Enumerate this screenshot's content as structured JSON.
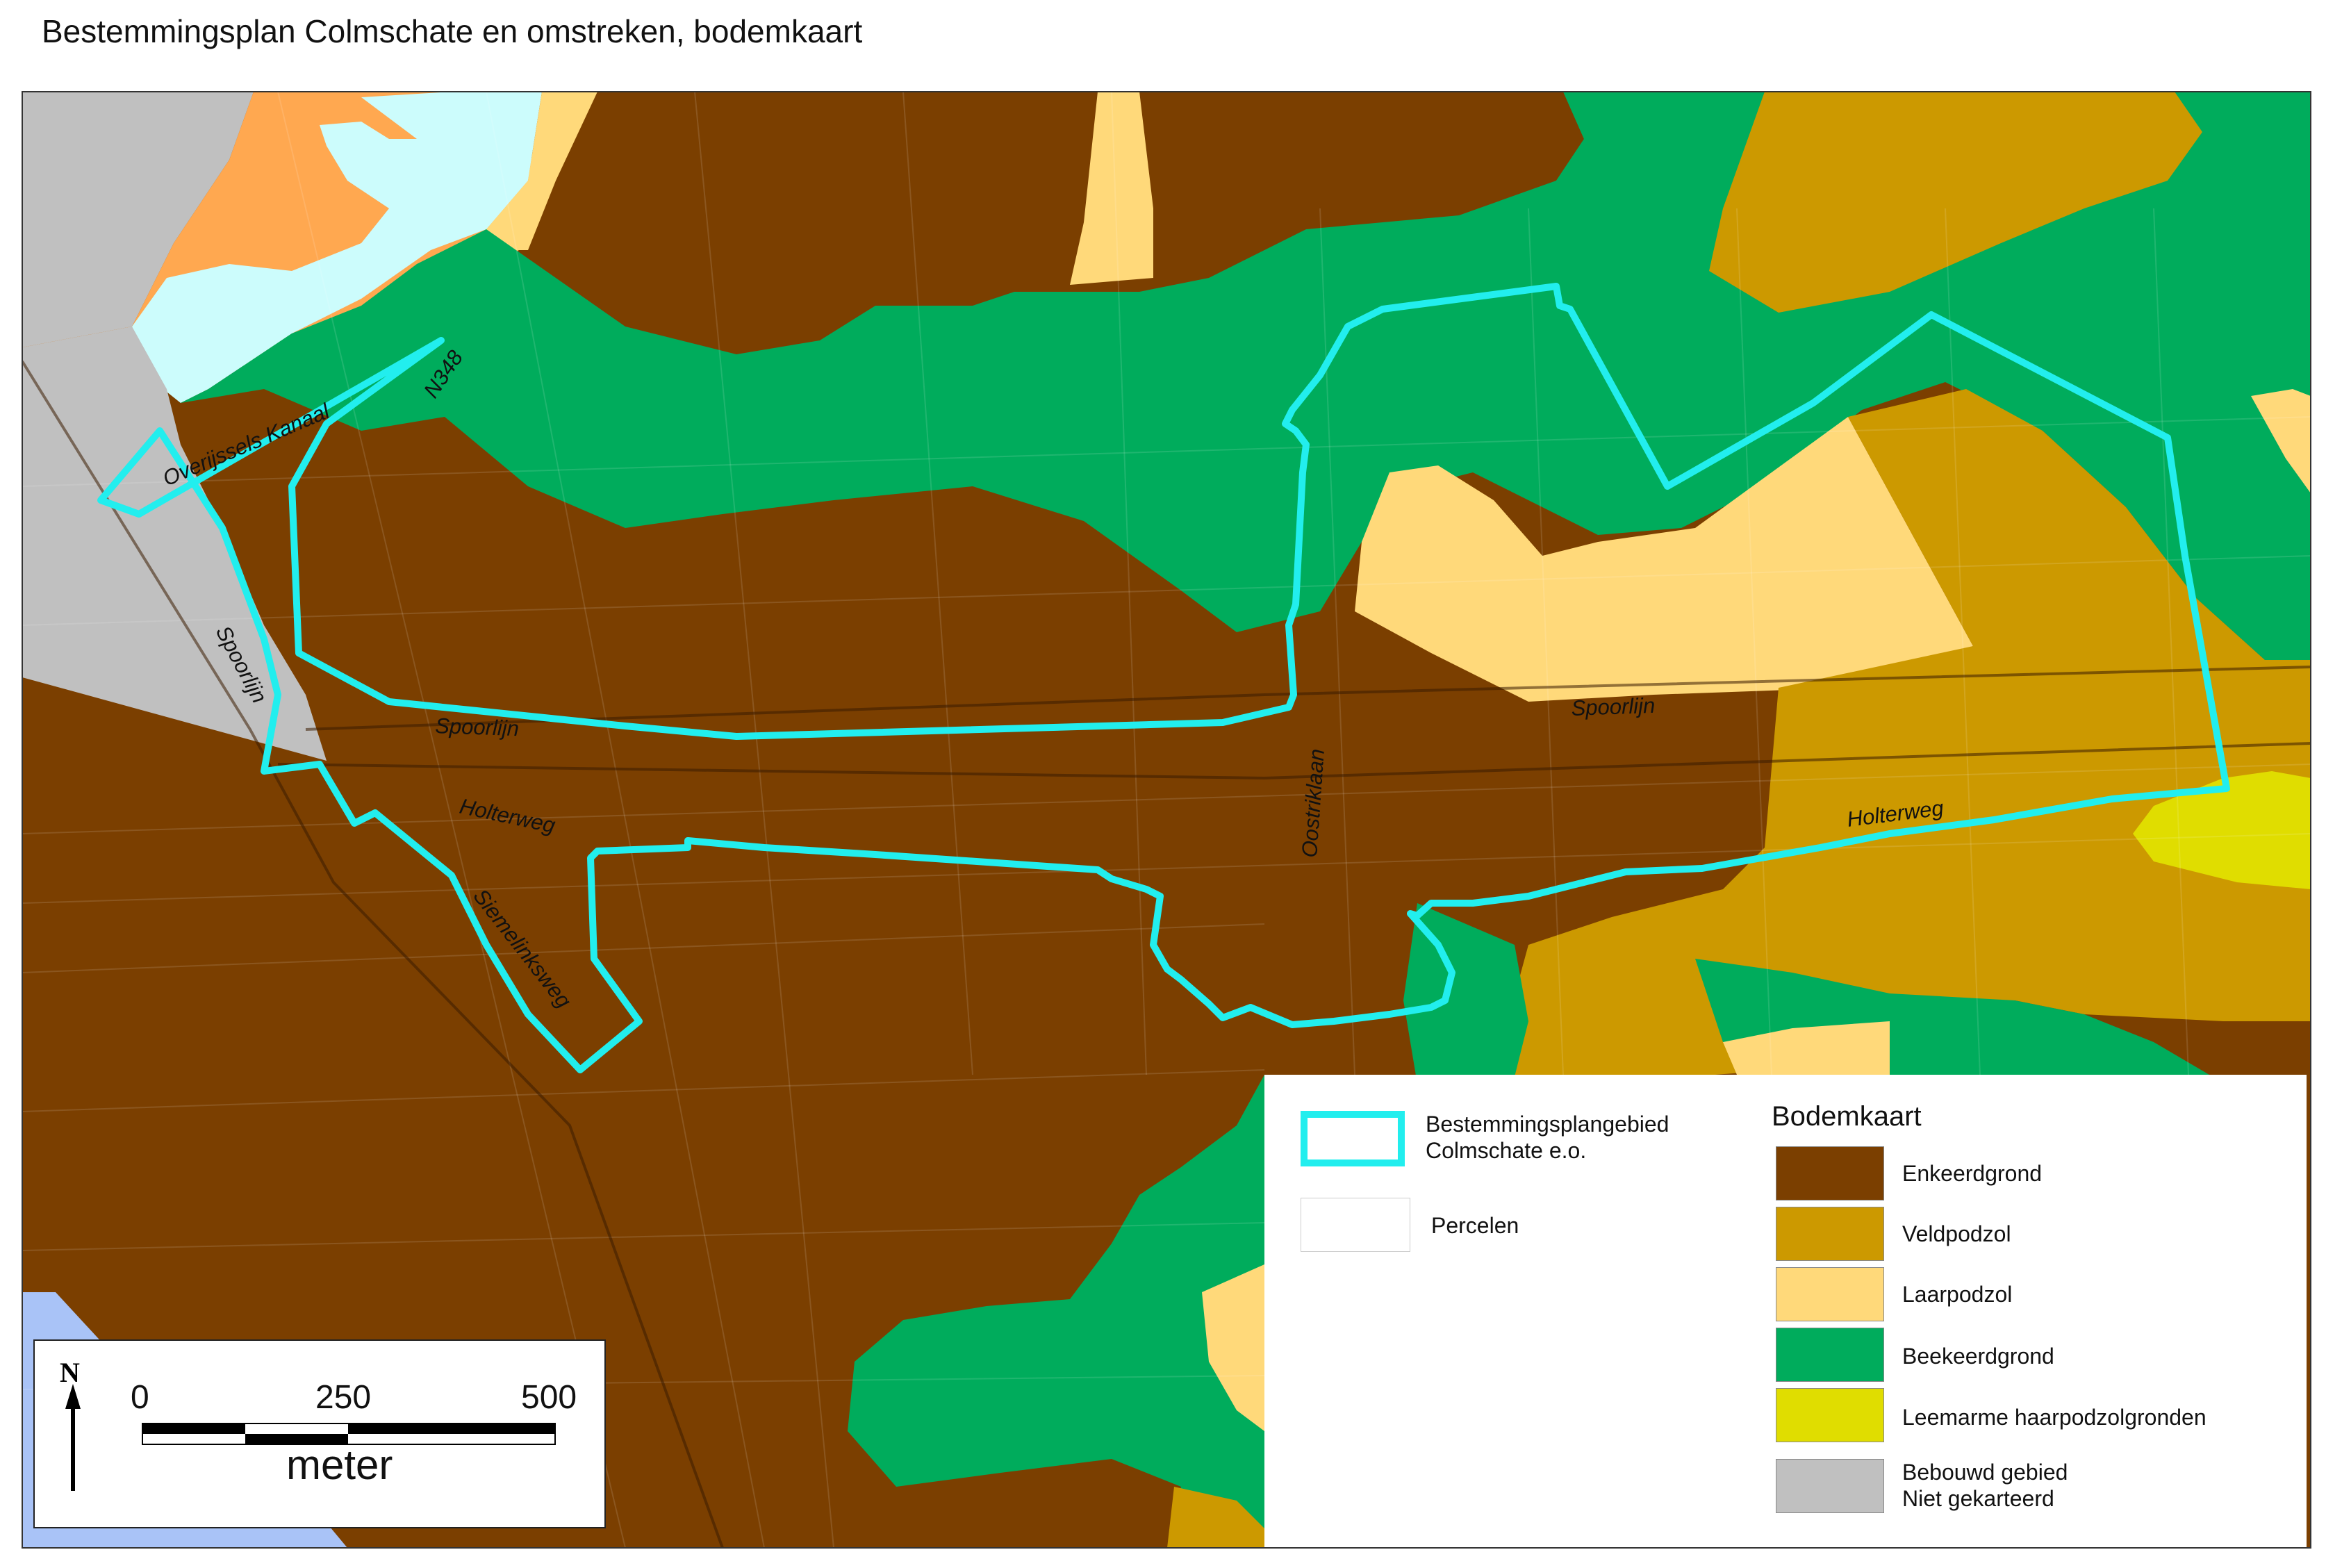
{
  "title": "Bestemmingsplan Colmschate en omstreken, bodemkaart",
  "colors": {
    "enkeerdgrond": "#7b3f00",
    "veldpodzol": "#cc9900",
    "laarpodzol": "#ffd97a",
    "beekeerdgrond": "#00ac5c",
    "leemarme": "#e0dd00",
    "bebouwd": "#c0c0c0",
    "water": "#ccfcfc",
    "water_blue": "#a9c3f7",
    "orange": "#ffa850",
    "plan_boundary": "#22eeee"
  },
  "map_labels": {
    "overijssels_kanaal": "Overijssels Kanaal",
    "n348": "N348",
    "spoorlijn_west": "Spoorlijn",
    "spoorlijn_center": "Spoorlijn",
    "spoorlijn_east": "Spoorlijn",
    "holterweg_west": "Holterweg",
    "holterweg_east": "Holterweg",
    "oostriklaan": "Oostriklaan",
    "siemelinksweg": "Siemelinksweg"
  },
  "legend": {
    "plan_area": "Bestemmingsplangebied\nColmschate e.o.",
    "percelen": "Percelen",
    "heading": "Bodemkaart",
    "items": [
      {
        "label": "Enkeerdgrond",
        "color": "#7b3f00"
      },
      {
        "label": "Veldpodzol",
        "color": "#cc9900"
      },
      {
        "label": "Laarpodzol",
        "color": "#ffd97a"
      },
      {
        "label": "Beekeerdgrond",
        "color": "#00ac5c"
      },
      {
        "label": "Leemarme haarpodzolgronden",
        "color": "#e0dd00"
      },
      {
        "label": "Bebouwd gebied\nNiet gekarteerd",
        "color": "#c0c0c0"
      }
    ]
  },
  "scalebar": {
    "north": "N",
    "ticks": [
      "0",
      "250",
      "500"
    ],
    "unit": "meter"
  }
}
